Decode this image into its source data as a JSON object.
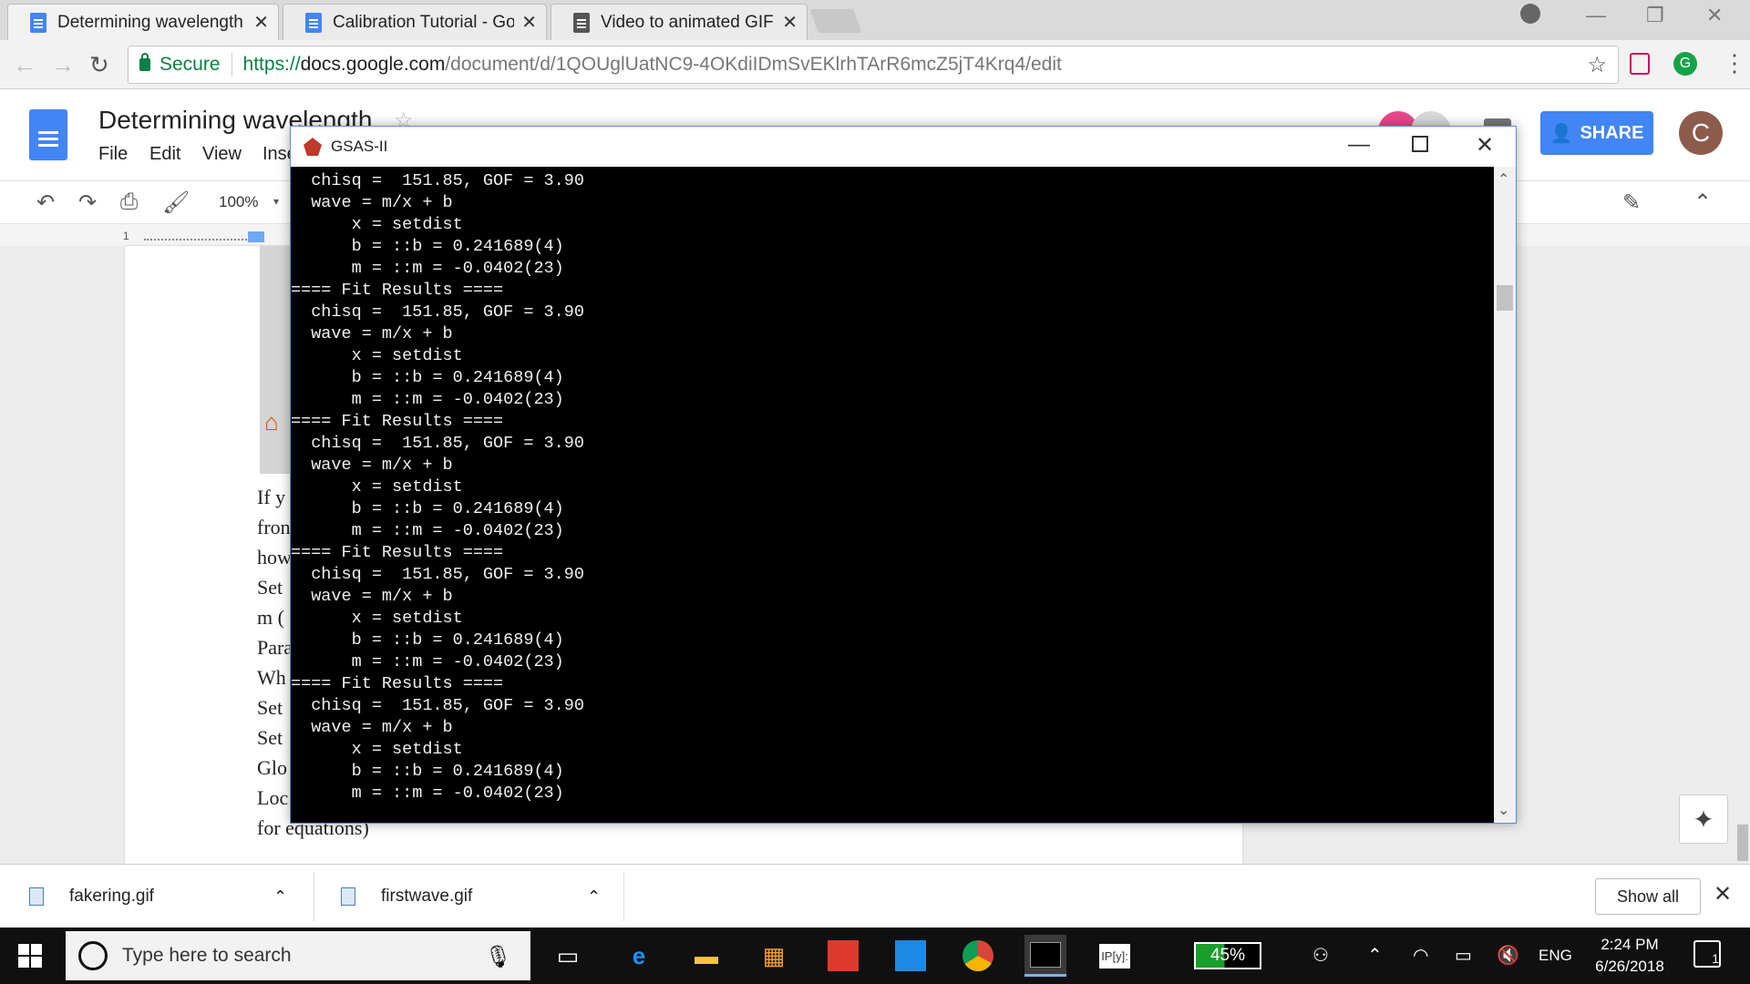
{
  "browser": {
    "tabs": [
      {
        "label": "Determining wavelength"
      },
      {
        "label": "Calibration Tutorial - Goo"
      },
      {
        "label": "Video to animated GIF co"
      }
    ],
    "secure_label": "Secure",
    "url_scheme": "https://",
    "url_host": "docs.google.com",
    "url_path": "/document/d/1QOUglUatNC9-4OKdiIDmSvEKlrhTArR6mcZ5jT4Krq4/edit"
  },
  "docs": {
    "title": "Determining wavelength",
    "menu": [
      "File",
      "Edit",
      "View",
      "Inse"
    ],
    "zoom": "100%",
    "share_label": "SHARE",
    "avatar_letter": "C",
    "ruler_label": "1",
    "body_fragments": [
      "If y",
      "fron",
      "how",
      "Set",
      "m (",
      "Para",
      "Wh",
      "Set",
      "Set",
      "Glo",
      "Loc",
      "for equations)"
    ]
  },
  "gsas": {
    "title": "GSAS-II",
    "console_lines": [
      "  chisq =  151.85, GOF = 3.90",
      "  wave = m/x + b",
      "      x = setdist",
      "      b = ::b = 0.241689(4)",
      "      m = ::m = -0.0402(23)",
      "==== Fit Results ====",
      "  chisq =  151.85, GOF = 3.90",
      "  wave = m/x + b",
      "      x = setdist",
      "      b = ::b = 0.241689(4)",
      "      m = ::m = -0.0402(23)",
      "==== Fit Results ====",
      "  chisq =  151.85, GOF = 3.90",
      "  wave = m/x + b",
      "      x = setdist",
      "      b = ::b = 0.241689(4)",
      "      m = ::m = -0.0402(23)",
      "==== Fit Results ====",
      "  chisq =  151.85, GOF = 3.90",
      "  wave = m/x + b",
      "      x = setdist",
      "      b = ::b = 0.241689(4)",
      "      m = ::m = -0.0402(23)",
      "==== Fit Results ====",
      "  chisq =  151.85, GOF = 3.90",
      "  wave = m/x + b",
      "      x = setdist",
      "      b = ::b = 0.241689(4)",
      "      m = ::m = -0.0402(23)"
    ]
  },
  "downloads": {
    "items": [
      {
        "name": "fakering.gif"
      },
      {
        "name": "firstwave.gif"
      }
    ],
    "show_all": "Show all"
  },
  "taskbar": {
    "search_placeholder": "Type here to search",
    "battery": "45%",
    "language": "ENG",
    "time": "2:24 PM",
    "date": "6/26/2018",
    "notifications": "1",
    "ipy_label": "IP[y]:"
  },
  "colors": {
    "accent": "#4285f4",
    "console_bg": "#000000",
    "secure_green": "#0b8043"
  }
}
